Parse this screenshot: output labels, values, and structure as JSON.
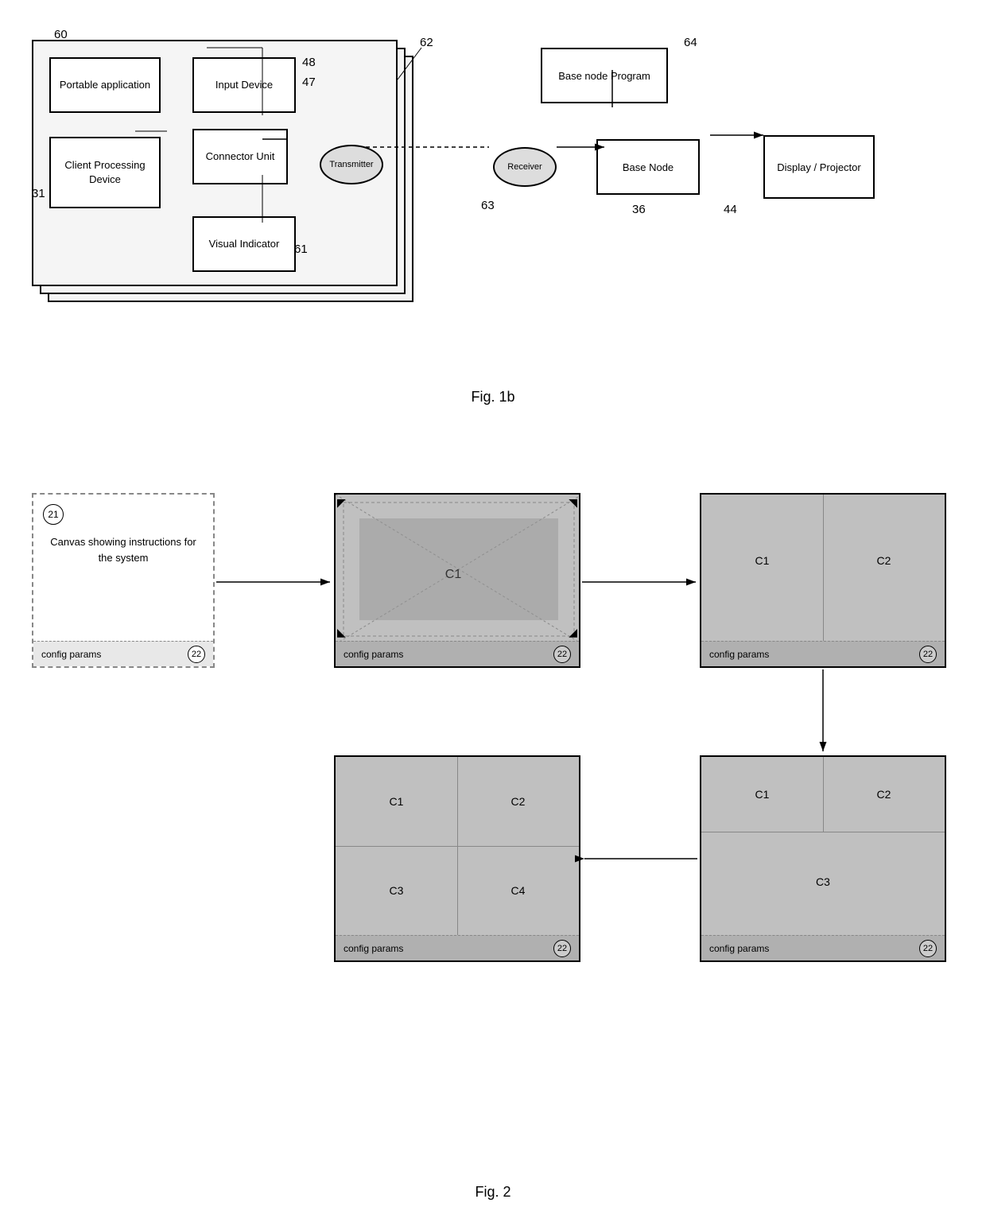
{
  "fig1b": {
    "label": "Fig. 1b",
    "label60": "60",
    "label31": "31",
    "label48": "48",
    "label47": "47",
    "label62": "62",
    "label63": "63",
    "label36": "36",
    "label44": "44",
    "label64": "64",
    "label61": "61",
    "boxes": {
      "portableApp": "Portable application",
      "inputDevice": "Input Device",
      "clientProcessing": "Client Processing Device",
      "connectorUnit": "Connector Unit",
      "visualIndicator": "Visual Indicator",
      "transmitter": "Transmitter",
      "receiver": "Receiver",
      "baseNodeProgram": "Base node Program",
      "baseNode": "Base Node",
      "displayProjector": "Display / Projector"
    }
  },
  "fig2": {
    "label": "Fig. 2",
    "boxes": {
      "canvasText": "Canvas showing instructions for the system",
      "configParams": "config params",
      "badgeLabel": "22",
      "circleLabel": "21",
      "c1": "C1",
      "c2": "C2",
      "c3": "C3",
      "c4": "C4"
    }
  }
}
